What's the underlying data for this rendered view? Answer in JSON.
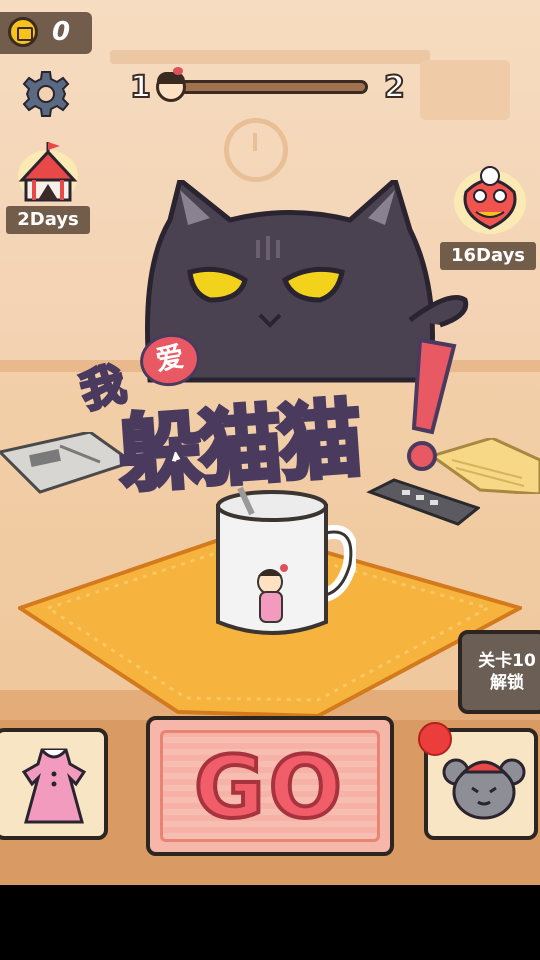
{
  "hud": {
    "coins": "0",
    "level_current": "1",
    "level_next": "2",
    "level_progress": 0.0
  },
  "events": {
    "left_badge": "2Days",
    "right_badge": "16Days"
  },
  "logo": {
    "small_chars": "我",
    "heart_char": "爱",
    "big_chars": "躲猫猫"
  },
  "bottom": {
    "go_label": "GO",
    "unlock_line1": "关卡10",
    "unlock_line2": "解锁"
  },
  "colors": {
    "cat": "#4a4250",
    "cat_eye": "#f2d21a",
    "placemat": "#f6b33d",
    "go_red": "#f25d6a"
  },
  "icons": [
    "coin-icon",
    "gear-icon",
    "circus-tent-icon",
    "lion-dance-icon",
    "dress-icon",
    "mouse-icon"
  ]
}
